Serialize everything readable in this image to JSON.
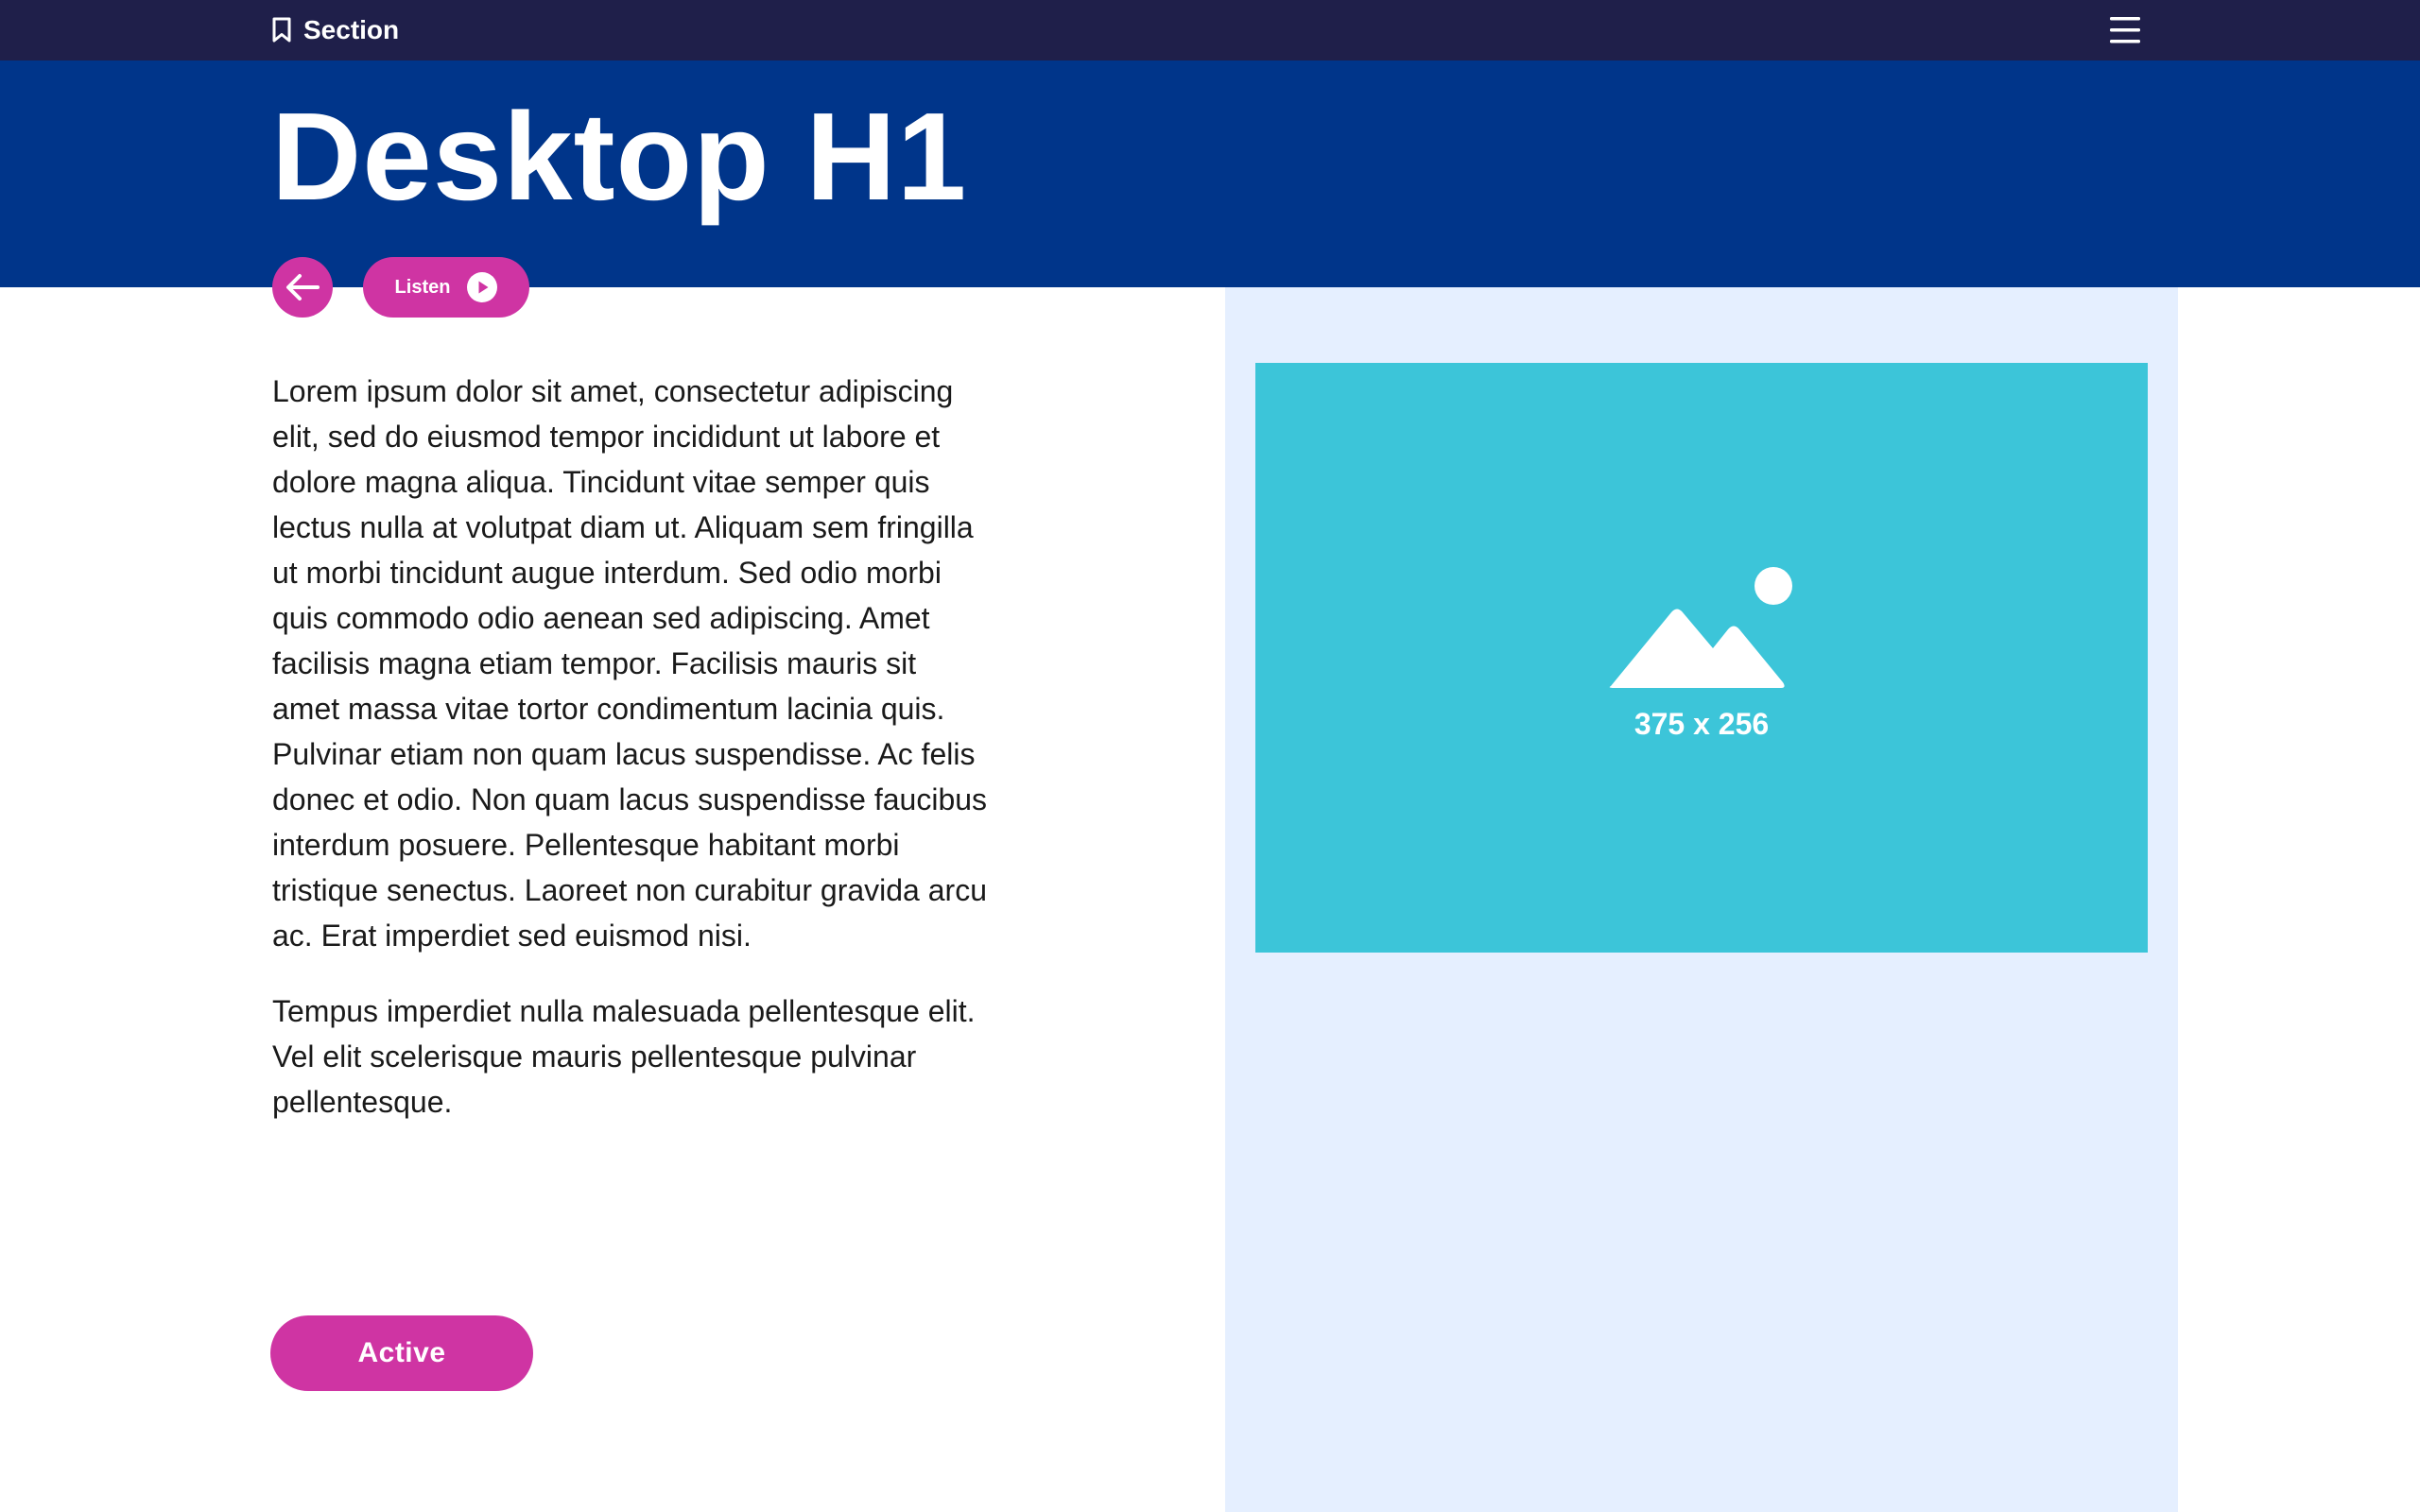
{
  "nav": {
    "section_label": "Section",
    "section_icon": "bookmark-icon",
    "menu_icon": "hamburger-menu-icon"
  },
  "hero": {
    "title": "Desktop H1"
  },
  "controls": {
    "back_icon": "arrow-left-icon",
    "listen_label": "Listen",
    "listen_icon": "play-circle-icon"
  },
  "content": {
    "paragraphs": [
      "Lorem ipsum dolor sit amet, consectetur adipiscing elit, sed do eiusmod tempor incididunt ut labore et dolore magna aliqua. Tincidunt vitae semper quis lectus nulla at volutpat diam ut. Aliquam sem fringilla ut morbi tincidunt augue interdum. Sed odio morbi quis commodo odio aenean sed adipiscing. Amet facilisis magna etiam tempor. Facilisis mauris sit amet massa vitae tortor condimentum lacinia quis. Pulvinar etiam non quam lacus suspendisse. Ac felis donec et odio. Non quam lacus suspendisse faucibus interdum posuere. Pellentesque habitant morbi tristique senectus. Laoreet non curabitur gravida arcu ac. Erat imperdiet sed euismod nisi.",
      "Tempus imperdiet nulla malesuada pellentesque elit. Vel elit scelerisque mauris pellentesque pulvinar pellentesque."
    ],
    "button_label": "Active"
  },
  "aside": {
    "image_caption": "375 x 256",
    "image_icon": "image-placeholder-icon"
  },
  "colors": {
    "topbar": "#1f1f4a",
    "hero": "#00358a",
    "accent": "#cf34a3",
    "aside_background": "#e5efff",
    "image_placeholder": "#3cc5d9"
  }
}
